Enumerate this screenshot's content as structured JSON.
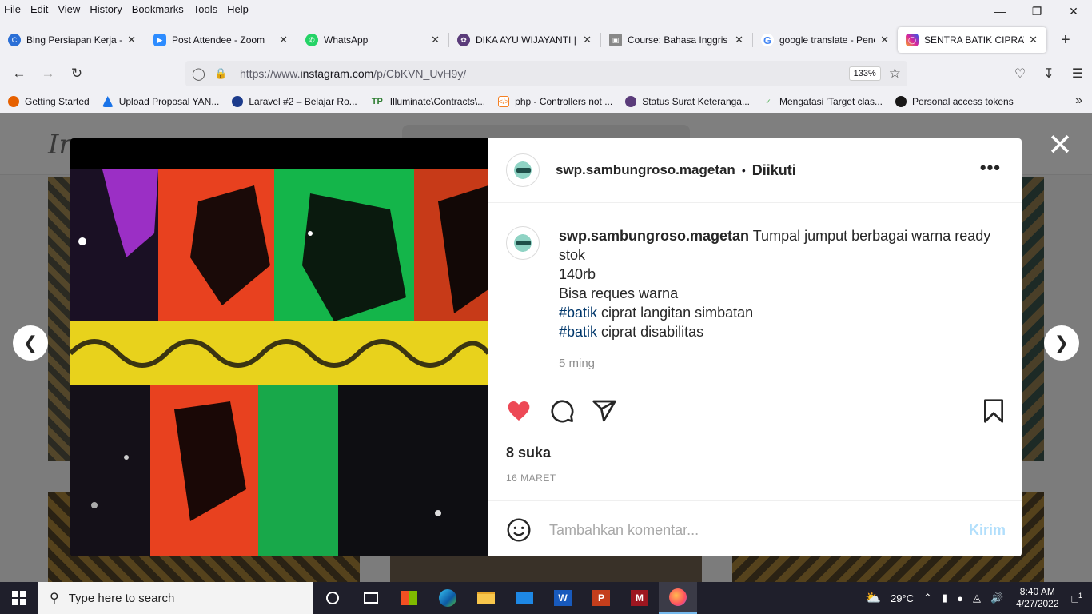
{
  "menu": [
    "File",
    "Edit",
    "View",
    "History",
    "Bookmarks",
    "Tools",
    "Help"
  ],
  "tabs": [
    {
      "label": "Bing Persiapan Kerja - Pr",
      "icon": "bing-icon",
      "color": "#2b6fd6"
    },
    {
      "label": "Post Attendee - Zoom",
      "icon": "zoom-icon",
      "color": "#2d8cff"
    },
    {
      "label": "WhatsApp",
      "icon": "whatsapp-icon",
      "color": "#25d366"
    },
    {
      "label": "DIKA AYU WIJAYANTI | Sp",
      "icon": "university-icon",
      "color": "#5a3b7a"
    },
    {
      "label": "Course: Bahasa Inggris Pe",
      "icon": "course-icon",
      "color": "#888888"
    },
    {
      "label": "google translate - Penelu",
      "icon": "google-icon",
      "color": "#ffffff"
    },
    {
      "label": "SENTRA BATIK CIPRAT",
      "icon": "instagram-icon",
      "color": "#d6249f",
      "active": true
    }
  ],
  "url": {
    "prefix": "https://www.",
    "domain": "instagram.com",
    "path": "/p/CbKVN_UvH9y/"
  },
  "zoom": "133%",
  "bookmarks": [
    {
      "label": "Getting Started",
      "color": "#e66000"
    },
    {
      "label": "Upload Proposal YAN...",
      "color": "#1a73e8"
    },
    {
      "label": "Laravel #2 – Belajar Ro...",
      "color": "#1c3b8c"
    },
    {
      "label": "Illuminate\\Contracts\\...",
      "color": "#2e7d32"
    },
    {
      "label": "php - Controllers not ...",
      "color": "#f48024"
    },
    {
      "label": "Status Surat Keteranga...",
      "color": "#5a3b7a"
    },
    {
      "label": "Mengatasi 'Target clas...",
      "color": "#4caf50"
    },
    {
      "label": "Personal access tokens",
      "color": "#181717"
    }
  ],
  "post": {
    "username": "swp.sambungroso.magetan",
    "follow_status": "Diikuti",
    "caption_lines": [
      "Tumpal jumput berbagai warna ready stok",
      "140rb",
      "Bisa reques warna"
    ],
    "hashtag_lines": [
      {
        "tag": "#batik",
        "rest": " ciprat langitan simbatan"
      },
      {
        "tag": "#batik",
        "rest": " ciprat disabilitas"
      }
    ],
    "time_ago": "5 ming",
    "likes": "8 suka",
    "date": "16 MARET",
    "comment_placeholder": "Tambahkan komentar...",
    "send_label": "Kirim"
  },
  "taskbar": {
    "search_placeholder": "Type here to search",
    "weather": "29°C",
    "time": "8:40 AM",
    "date": "4/27/2022",
    "notification_count": "1"
  },
  "colors": {
    "heart": "#ed4956",
    "link": "#00376b",
    "send": "#b2dffc"
  }
}
